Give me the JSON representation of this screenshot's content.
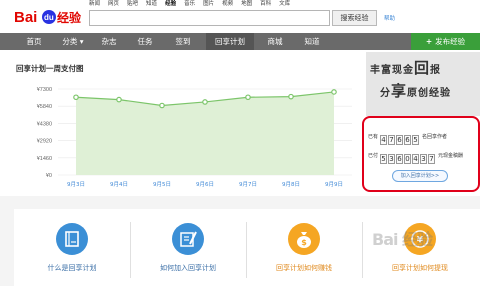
{
  "header": {
    "logo_text": "Bai du 经验",
    "top_nav": [
      "新闻",
      "网页",
      "贴吧",
      "知道",
      "经验",
      "音乐",
      "图片",
      "视频",
      "地图",
      "百科",
      "文库"
    ],
    "active_top_nav": 4,
    "search_value": "",
    "search_button": "搜索经验",
    "help_link": "帮助"
  },
  "navbar": {
    "items": [
      "首页",
      "分类 ▾",
      "杂志",
      "任务",
      "签到",
      "回享计划",
      "商城",
      "知道"
    ],
    "active_index": 5,
    "publish_label": "发布经验",
    "publish_icon": "plus-icon"
  },
  "chart_panel": {
    "title": "回享计划一周支付图"
  },
  "chart_data": {
    "type": "area",
    "categories": [
      "9月3日",
      "9月4日",
      "9月5日",
      "9月6日",
      "9月7日",
      "9月8日",
      "9月9日"
    ],
    "y_tick_labels": [
      "¥7300",
      "¥5840",
      "¥4380",
      "¥2920",
      "¥1460",
      "¥0"
    ],
    "values": [
      6600,
      6400,
      5900,
      6200,
      6600,
      6650,
      7050
    ],
    "ylim": [
      0,
      7300
    ],
    "colors": {
      "line": "#7cc56a",
      "fill": "#dff0d6",
      "point": "#7cc56a"
    },
    "grid": true
  },
  "promo": {
    "line1": "丰富现金",
    "big1": "回",
    "line1b": "报",
    "line2": "分",
    "big2": "享",
    "line2b": "原创经验"
  },
  "stats": {
    "row1": {
      "label": "已有",
      "digits": [
        "4",
        "7",
        "6",
        "6",
        "5"
      ],
      "unit": "名回享作者"
    },
    "row2": {
      "label": "已付",
      "digits": [
        "5",
        "3",
        "6",
        "0",
        "4",
        "3",
        "7"
      ],
      "unit": "元现金稿酬"
    },
    "join_button": "加入回享计划>>",
    "highlight_color": "#e0001a"
  },
  "features": [
    {
      "label": "什么是回享计划",
      "icon": "book-icon",
      "color": "#3b8fd6",
      "label_color": "#3b6fa7"
    },
    {
      "label": "如何加入回享计划",
      "icon": "edit-icon",
      "color": "#3b8fd6",
      "label_color": "#3b6fa7"
    },
    {
      "label": "回享计划如何赚钱",
      "icon": "money-bag-icon",
      "color": "#f5a623",
      "label_color": "#e08a1e"
    },
    {
      "label": "回享计划如何提现",
      "icon": "coin-icon",
      "color": "#f5a623",
      "label_color": "#e08a1e"
    }
  ],
  "watermark": "Bai 经验"
}
